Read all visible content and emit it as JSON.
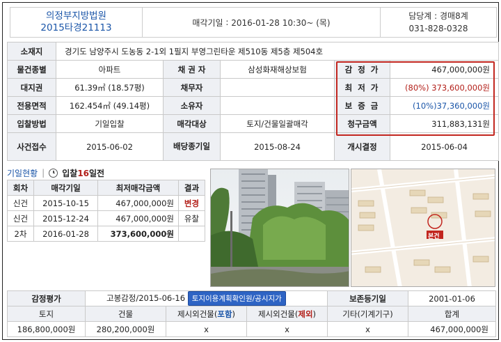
{
  "header": {
    "court": "의정부지방법원",
    "case_no": "2015타경21113",
    "sale_date_label": "매각기일",
    "sale_date_value": "2016-01-28 10:30~ (목)",
    "dept": "담당계 : 경매8계",
    "phone": "031-828-0328"
  },
  "info": {
    "location_label": "소재지",
    "location_value": "경기도 남양주시 도농동 2-1외 1필지 부영그린타운 제510동 제5층 제504호",
    "type_label": "물건종별",
    "type_value": "아파트",
    "creditor_label": "채 권 자",
    "creditor_value": "삼성화재해상보험",
    "land_label": "대지권",
    "land_value": "61.39㎡ (18.57평)",
    "debtor_label": "채무자",
    "debtor_value": "",
    "area_label": "전용면적",
    "area_value": "162.454㎡ (49.14평)",
    "owner_label": "소유자",
    "owner_value": "",
    "bid_method_label": "입찰방법",
    "bid_method_value": "기일입찰",
    "sale_target_label": "매각대상",
    "sale_target_value": "토지/건물일괄매각",
    "case_received_label": "사건접수",
    "case_received_value": "2015-06-02",
    "dividend_deadline_label": "배당종기일",
    "dividend_deadline_value": "2015-08-24",
    "start_decision_label": "개시결정",
    "start_decision_value": "2015-06-04"
  },
  "prices": {
    "appraisal_label": "감 정 가",
    "appraisal_value": "467,000,000원",
    "minimum_label": "최 저 가",
    "minimum_pct": "(80%)",
    "minimum_value": "373,600,000원",
    "deposit_label": "보 증 금",
    "deposit_value": "(10%)37,360,000원",
    "claim_label": "청구금액",
    "claim_value": "311,883,131원"
  },
  "history": {
    "link_label": "기일현황",
    "separator": "|",
    "bid_prefix": "입찰",
    "bid_days": "16",
    "bid_suffix": "일전",
    "columns": [
      "회차",
      "매각기일",
      "최저매각금액",
      "결과"
    ],
    "rows": [
      {
        "round": "신건",
        "date": "2015-10-15",
        "amount": "467,000,000원",
        "result": "변경",
        "result_color": "#b3201a"
      },
      {
        "round": "신건",
        "date": "2015-12-24",
        "amount": "467,000,000원",
        "result": "유찰",
        "result_color": "#222222"
      },
      {
        "round": "2차",
        "date": "2016-01-28",
        "amount": "373,600,000원",
        "result": "",
        "result_color": "#222222"
      }
    ]
  },
  "map": {
    "label": "본건"
  },
  "appraisal": {
    "label": "감정평가",
    "appraiser_value": "고봉감정/2015-06-16",
    "button_label": "토지이용계획확인원/공시지가",
    "preserve_label": "보존등기일",
    "preserve_value": "2001-01-06",
    "col_land": "토지",
    "col_building": "건물",
    "col_excl_incl_prefix": "제시외건물(",
    "col_excl_incl_word": "포함",
    "col_excl_excl_prefix": "제시외건물(",
    "col_excl_excl_word": "제외",
    "col_suffix": ")",
    "col_other": "기타(기계기구)",
    "col_total": "합계",
    "val_land": "186,800,000원",
    "val_building": "280,200,000원",
    "val_excl_incl": "x",
    "val_excl_excl": "x",
    "val_other": "x",
    "val_total": "467,000,000원"
  },
  "colors": {
    "accent_blue": "#1a55a8",
    "accent_red": "#b3201a",
    "highlight_box": "#c2261f",
    "label_bg": "#eef0f4"
  }
}
